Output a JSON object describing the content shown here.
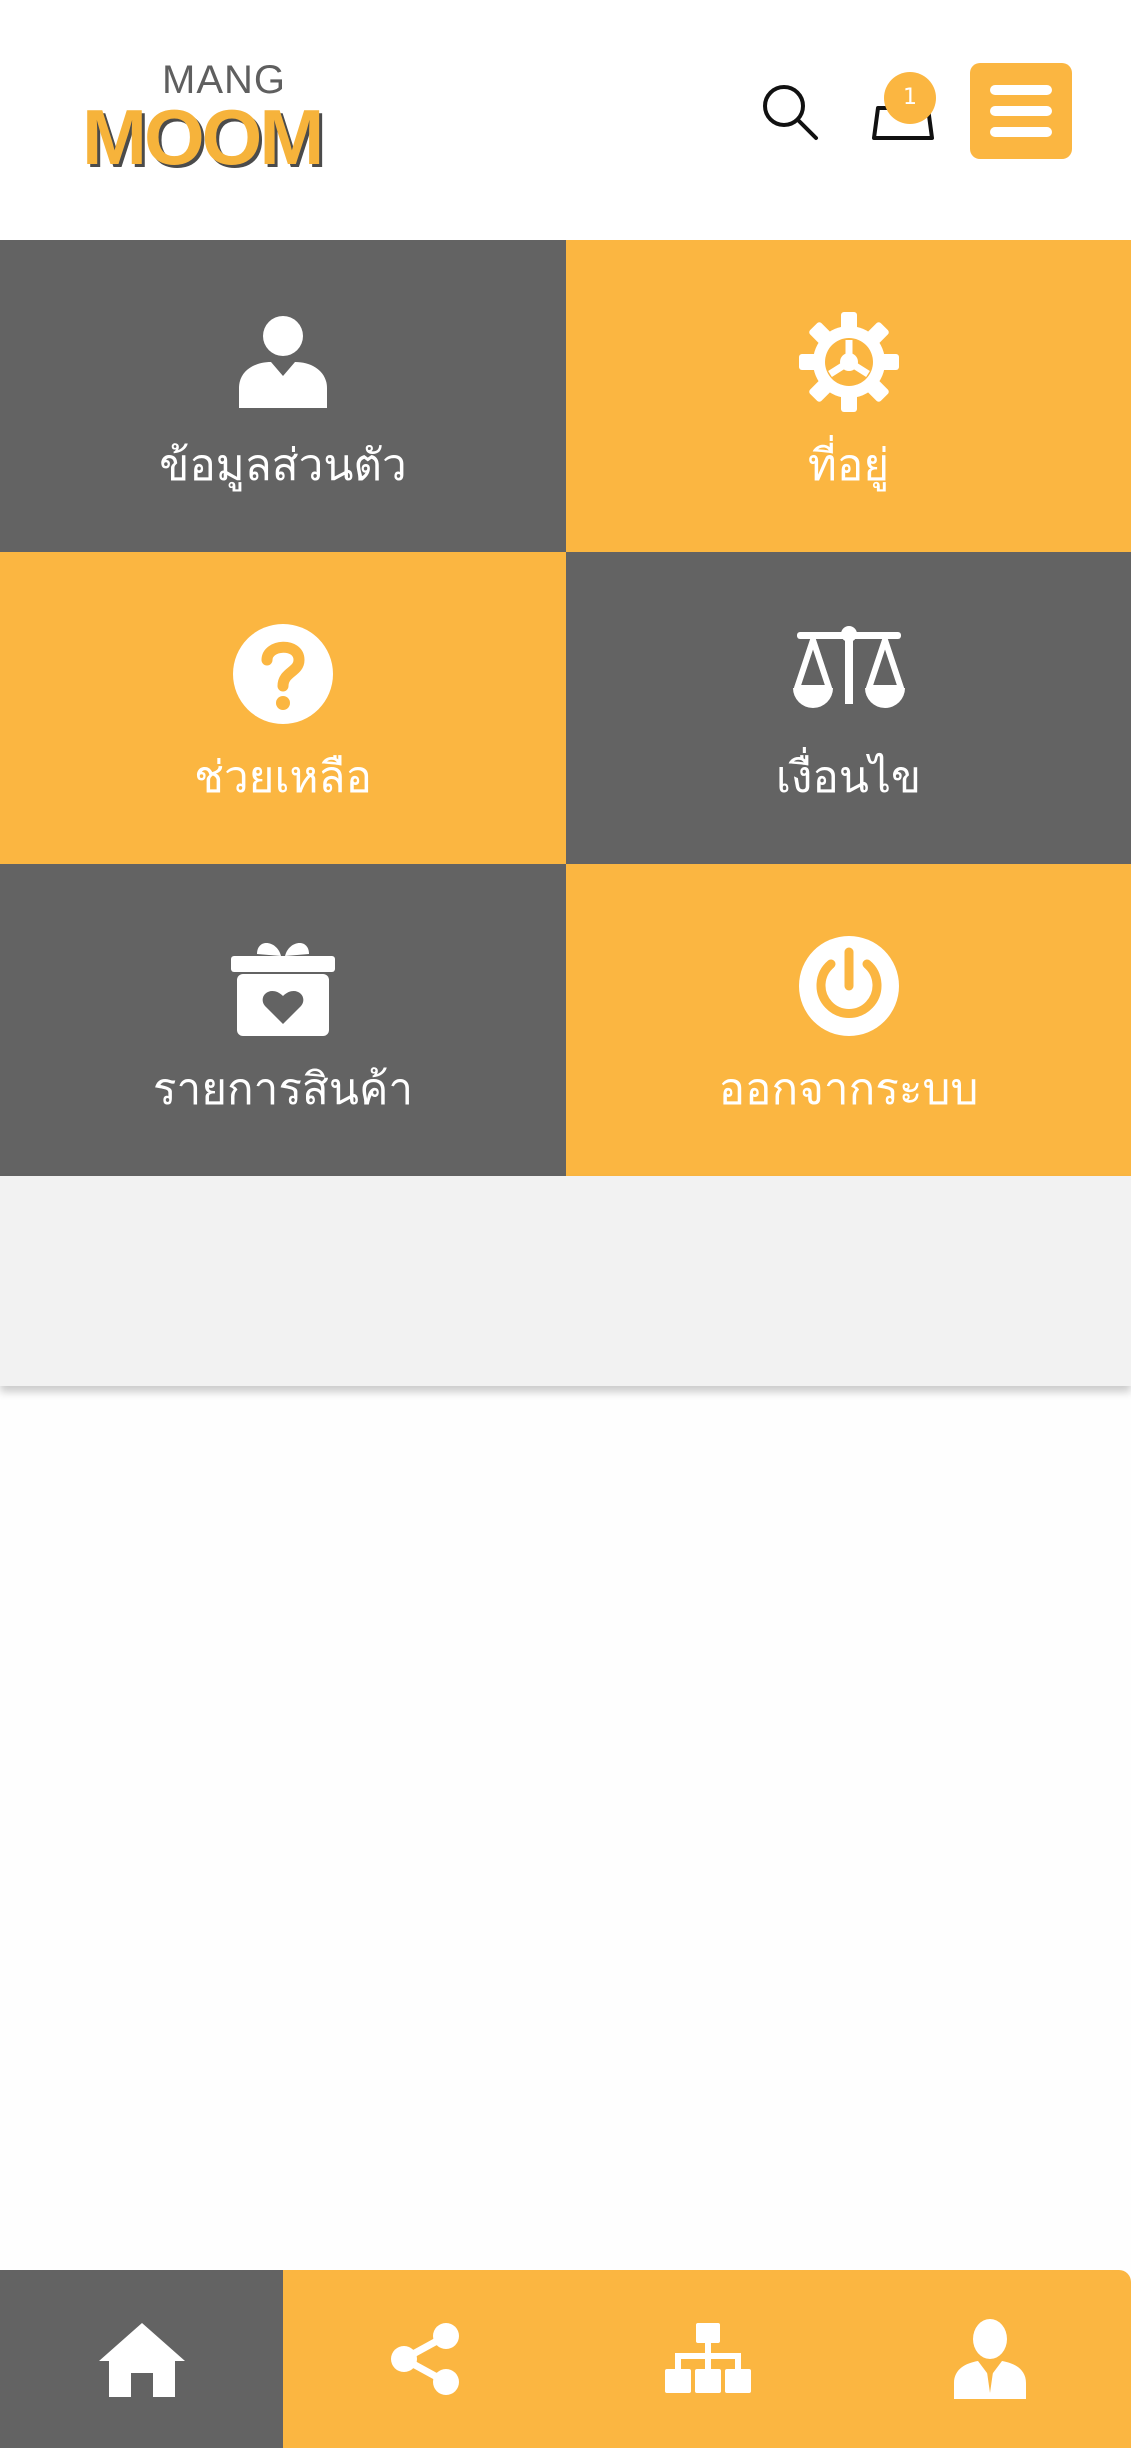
{
  "app": {
    "logo_top": "MANG",
    "logo_main": "MOOM"
  },
  "header": {
    "cart_count": "1"
  },
  "tiles": [
    {
      "label": "ข้อมูลส่วนตัว",
      "icon": "user-icon",
      "color": "#636363"
    },
    {
      "label": "ที่อยู่",
      "icon": "gear-icon",
      "color": "#fbb641"
    },
    {
      "label": "ช่วยเหลือ",
      "icon": "help-icon",
      "color": "#fbb641"
    },
    {
      "label": "เงื่อนไข",
      "icon": "scale-icon",
      "color": "#636363"
    },
    {
      "label": "รายการสินค้า",
      "icon": "gift-icon",
      "color": "#636363"
    },
    {
      "label": "ออกจากระบบ",
      "icon": "power-icon",
      "color": "#fbb641"
    }
  ],
  "bottom_nav": [
    {
      "icon": "home-icon",
      "active": true
    },
    {
      "icon": "share-icon",
      "active": false
    },
    {
      "icon": "sitemap-icon",
      "active": false
    },
    {
      "icon": "account-icon",
      "active": false
    }
  ],
  "colors": {
    "accent": "#fbb641",
    "dark": "#636363",
    "panel": "#f2f2f2"
  }
}
